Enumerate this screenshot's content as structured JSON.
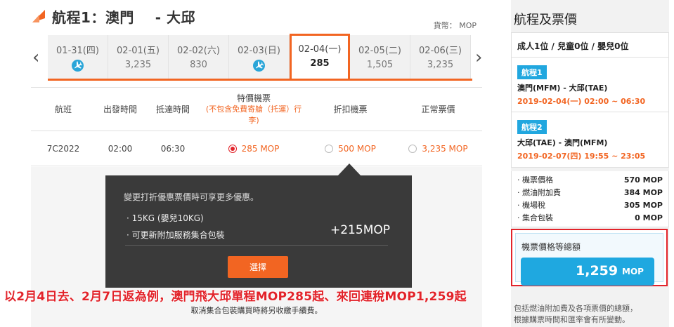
{
  "main": {
    "title": "航程1：澳門    - 大邱",
    "currency_label": "貨幣： MOP",
    "dates": [
      {
        "date": "01-31(四)",
        "price": "",
        "icon": "plane-icon"
      },
      {
        "date": "02-01(五)",
        "price": "3,235"
      },
      {
        "date": "02-02(六)",
        "price": "830"
      },
      {
        "date": "02-03(日)",
        "price": "",
        "icon": "plane-icon"
      },
      {
        "date": "02-04(一)",
        "price": "285",
        "selected": true
      },
      {
        "date": "02-05(二)",
        "price": "1,505"
      },
      {
        "date": "02-06(三)",
        "price": "3,235"
      }
    ],
    "table": {
      "headers": {
        "flight": "航班",
        "departure": "出發時間",
        "arrival": "抵達時間",
        "promo": "特價機票",
        "promo_sub": "(不包含免費寄艙（托運）行李)",
        "discount": "折扣機票",
        "normal": "正常票價"
      },
      "row": {
        "flight": "7C2022",
        "departure": "02:00",
        "arrival": "06:30",
        "promo": "285 MOP",
        "discount": "500 MOP",
        "normal": "3,235 MOP"
      }
    },
    "tooltip": {
      "heading": "變更打折優惠票價時可享更多優惠。",
      "item1": "· 15KG (嬰兒10KG)",
      "item2": "· 可更新附加服務集合包裝",
      "price": "+215MOP",
      "button": "選擇"
    },
    "promo_caption": "以2月4日去、2月7日返為例，澳門飛大邱單程MOP285起、來回連稅MOP1,259起",
    "cancel_note": "取消集合包裝購買時將另收繳手續費。"
  },
  "summary": {
    "title": "航程及票價",
    "passengers": "成人1位 / 兒童0位 / 嬰兒0位",
    "legs": [
      {
        "badge": "航程1",
        "route": "澳門(MFM) - 大邱(TAE)",
        "time": "2019-02-04(一) 02:00 ~ 06:30"
      },
      {
        "badge": "航程2",
        "route": "大邱(TAE) - 澳門(MFM)",
        "time": "2019-02-07(四) 19:55 ~ 23:05"
      }
    ],
    "costs": [
      {
        "label": "· 機票價格",
        "amount": "570 MOP"
      },
      {
        "label": "· 燃油附加費",
        "amount": "384 MOP"
      },
      {
        "label": "· 機場稅",
        "amount": "305 MOP"
      },
      {
        "label": "· 集合包裝",
        "amount": "0 MOP"
      }
    ],
    "total_label": "機票價格等總額",
    "total_amount": "1,259",
    "total_currency": "MOP",
    "note_line1": "包括燃油附加費及各項票價的總額，",
    "note_line2": "根據購票時間和匯率會有所變動。"
  },
  "colors": {
    "accent_orange": "#f26522",
    "accent_blue": "#1fa8e0",
    "highlight_red": "#e2232a"
  }
}
